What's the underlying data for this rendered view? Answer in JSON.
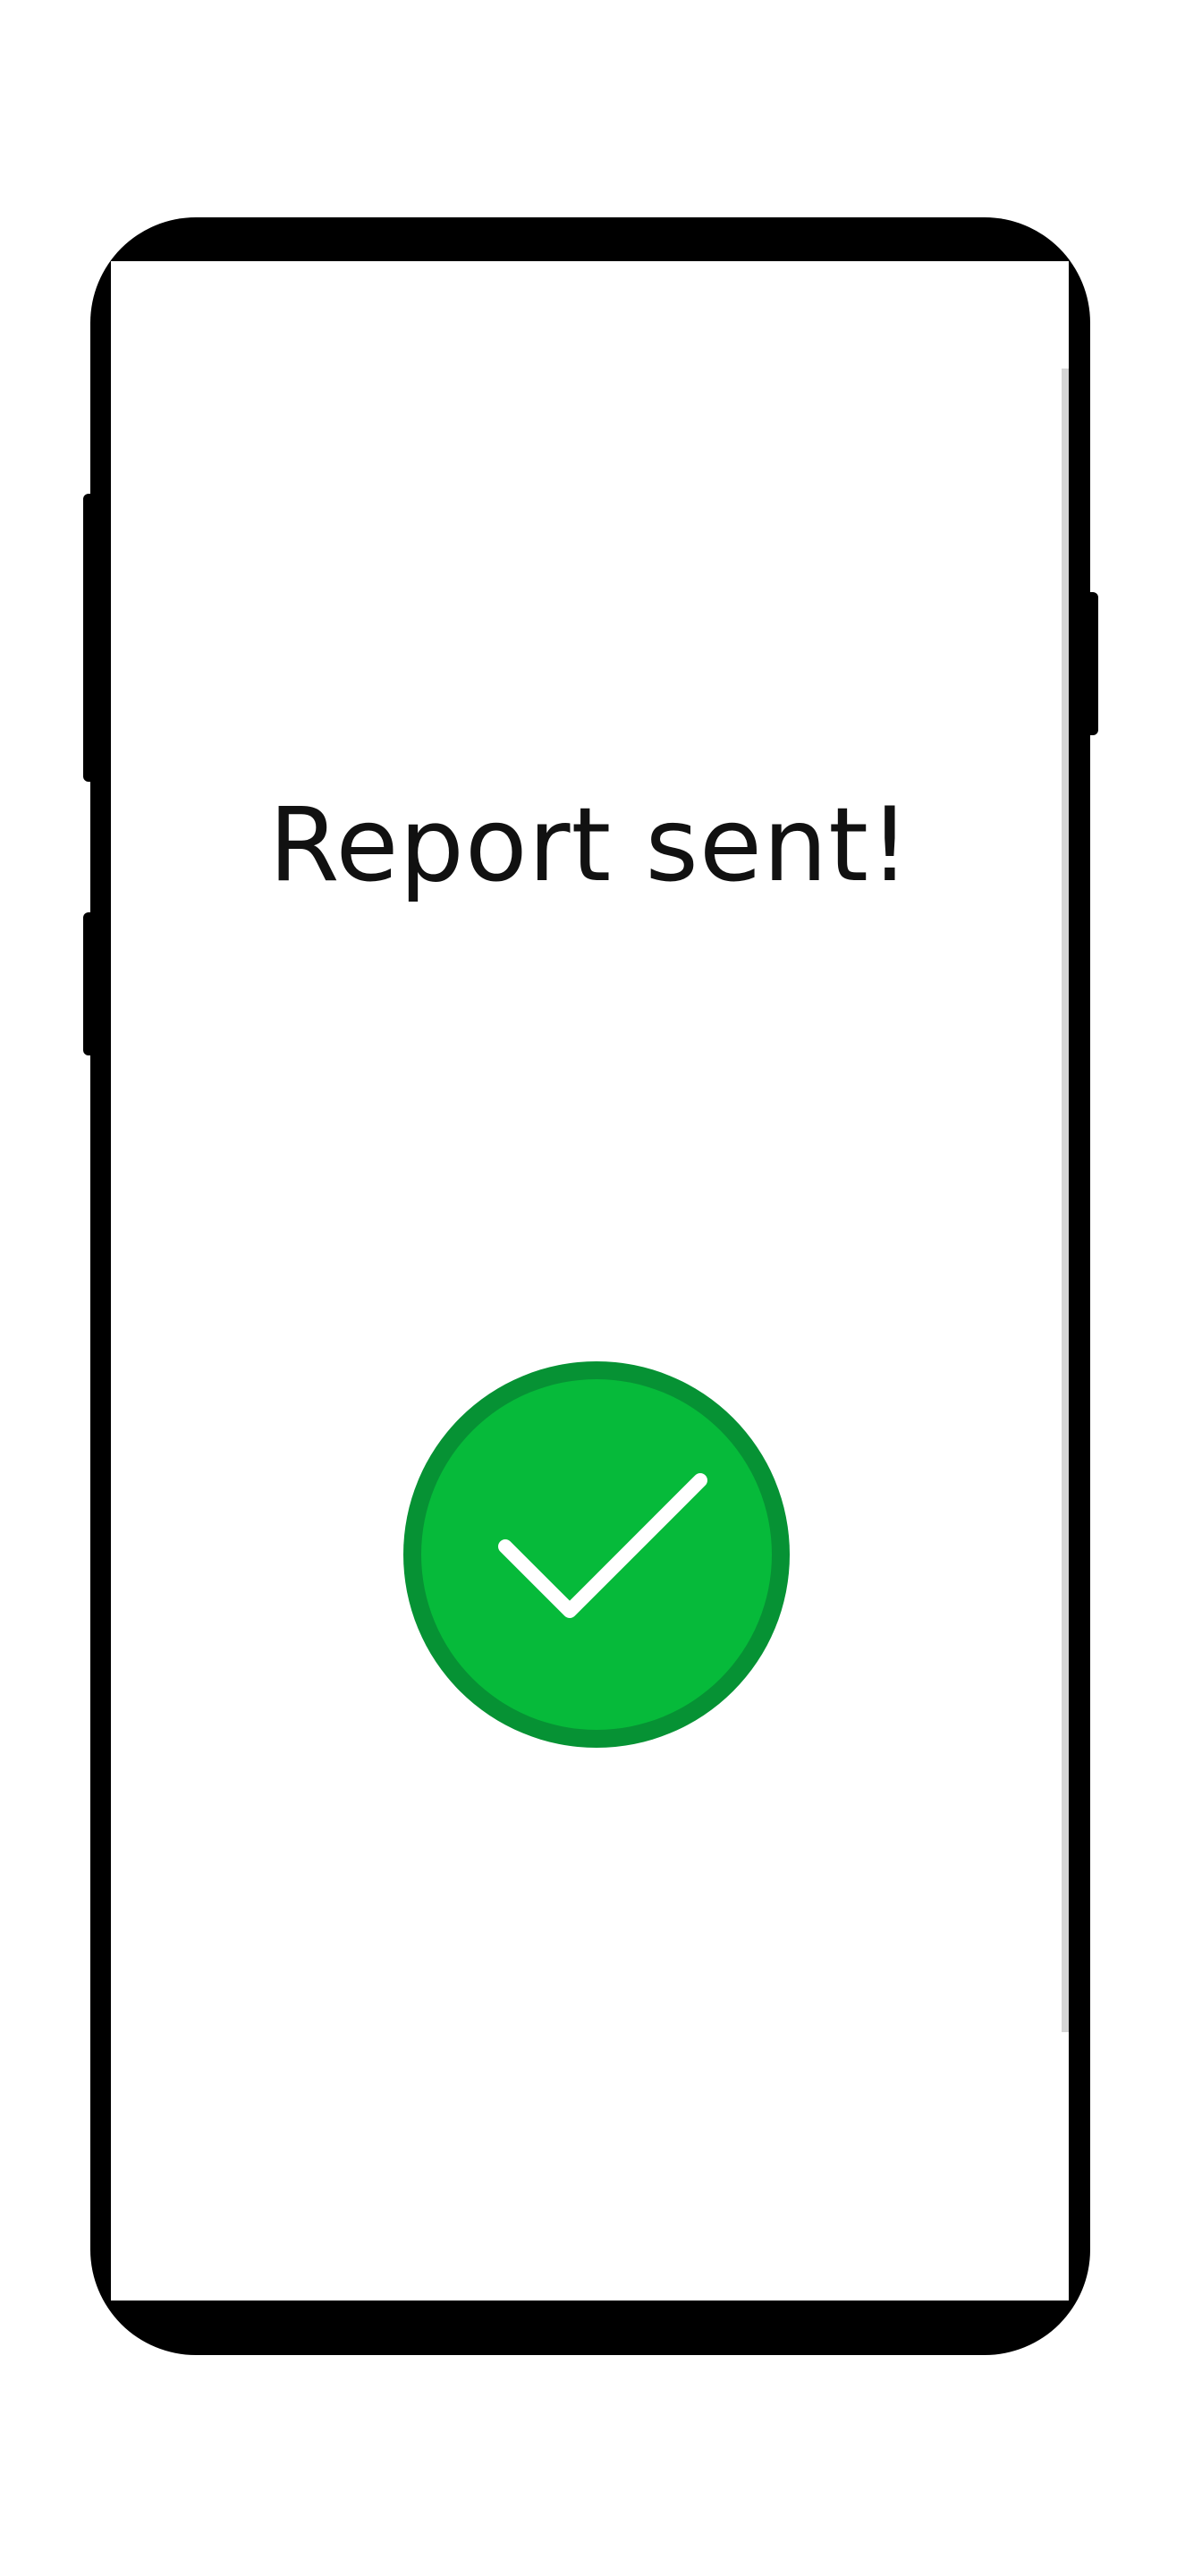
{
  "screen": {
    "title": "Report sent!",
    "status_icon": "check-circle-icon"
  },
  "colors": {
    "success_fill": "#06BA3A",
    "success_ring": "#069234",
    "check_mark": "#FFFFFF",
    "device_frame": "#000000"
  }
}
